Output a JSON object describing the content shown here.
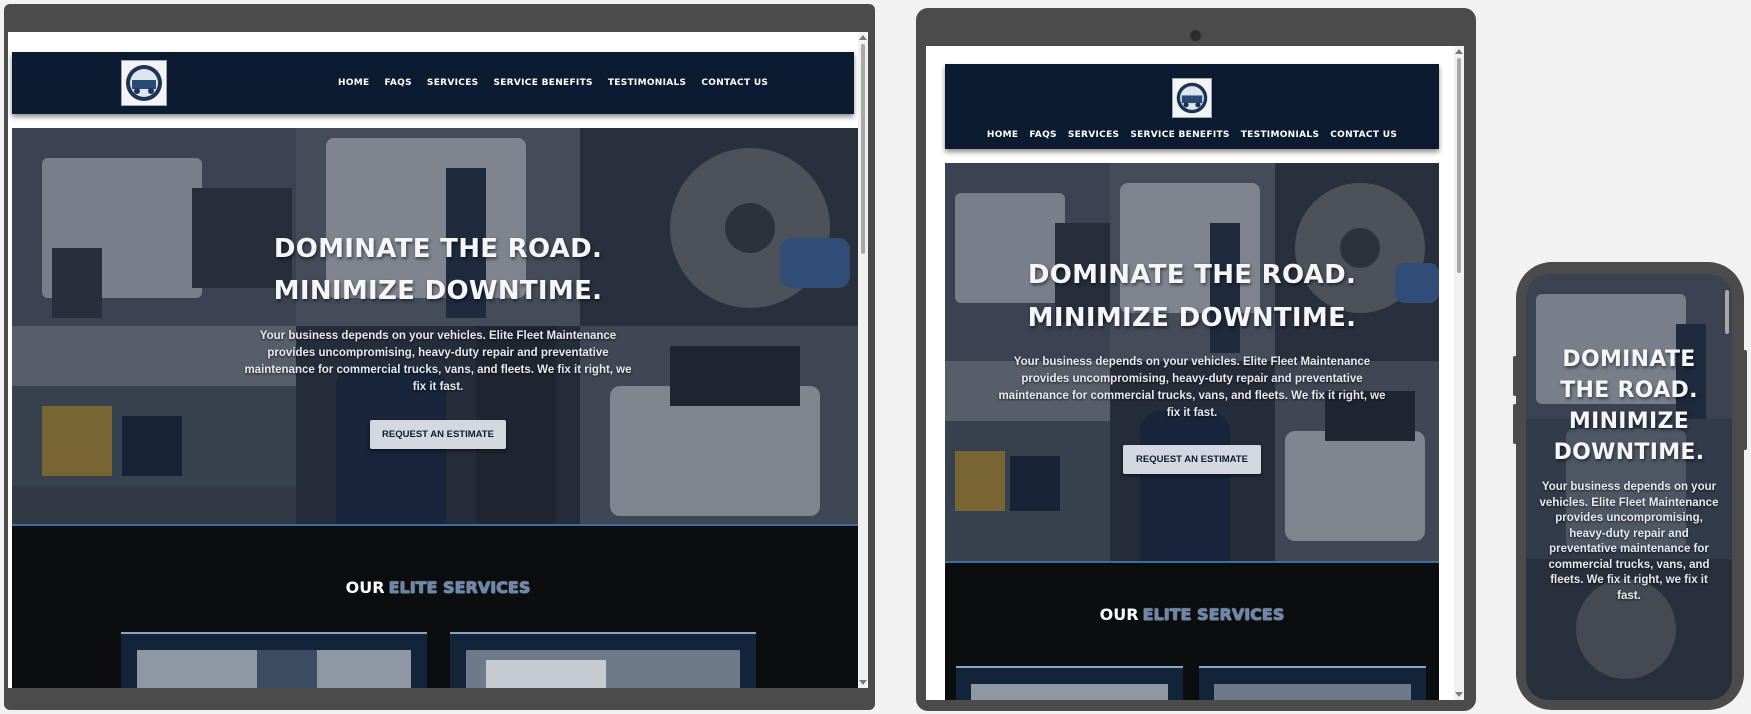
{
  "site": {
    "logo_name": "Elite Fleet Maintenance logo",
    "nav": [
      "HOME",
      "FAQS",
      "SERVICES",
      "SERVICE BENEFITS",
      "TESTIMONIALS",
      "CONTACT US"
    ],
    "hero": {
      "title_line1": "DOMINATE THE ROAD.",
      "title_line2": "MINIMIZE DOWNTIME.",
      "text": "Your business depends on your vehicles. Elite Fleet Maintenance provides uncompromising, heavy-duty repair and preventative maintenance for commercial trucks, vans, and fleets. We fix it right, we fix it fast.",
      "cta": "REQUEST AN ESTIMATE"
    },
    "services": {
      "title_part1": "OUR",
      "title_part2": "ELITE SERVICES"
    }
  },
  "devices": [
    "desktop",
    "tablet",
    "phone"
  ],
  "colors": {
    "navbar": "#0c1b30",
    "accent": "#6b86ad",
    "section_bg": "#0c0d0f",
    "cta_bg": "#d3d8e0",
    "device_frame": "#4b4b4b"
  },
  "icons": [
    "logo-badge-icon"
  ]
}
